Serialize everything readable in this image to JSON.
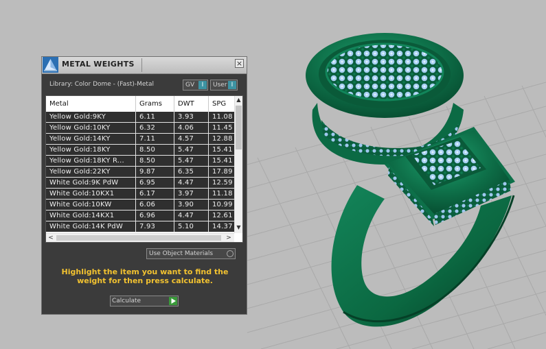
{
  "panel": {
    "title": "METAL WEIGHTS",
    "close_glyph": "×",
    "library_label": "Library: Color Dome - (Fast)-Metal",
    "toggles": [
      {
        "label": "GV",
        "indicator": "I"
      },
      {
        "label": "User",
        "indicator": "I"
      }
    ],
    "table": {
      "columns": [
        "Metal",
        "Grams",
        "DWT",
        "SPG"
      ],
      "rows": [
        [
          "Yellow Gold:9KY",
          "6.11",
          "3.93",
          "11.08"
        ],
        [
          "Yellow Gold:10KY",
          "6.32",
          "4.06",
          "11.45"
        ],
        [
          "Yellow Gold:14KY",
          "7.11",
          "4.57",
          "12.88"
        ],
        [
          "Yellow Gold:18KY",
          "8.50",
          "5.47",
          "15.41"
        ],
        [
          "Yellow Gold:18KY R...",
          "8.50",
          "5.47",
          "15.41"
        ],
        [
          "Yellow Gold:22KY",
          "9.87",
          "6.35",
          "17.89"
        ],
        [
          "White Gold:9K PdW",
          "6.95",
          "4.47",
          "12.59"
        ],
        [
          "White Gold:10KX1",
          "6.17",
          "3.97",
          "11.18"
        ],
        [
          "White Gold:10KW",
          "6.06",
          "3.90",
          "10.99"
        ],
        [
          "White Gold:14KX1",
          "6.96",
          "4.47",
          "12.61"
        ],
        [
          "White Gold:14K PdW",
          "7.93",
          "5.10",
          "14.37"
        ]
      ]
    },
    "scroll": {
      "up": "▲",
      "down": "▼",
      "left": "<",
      "right": ">"
    },
    "use_object_materials": "Use Object Materials",
    "instruction": "Highlight the item you want to find the weight for then press calculate.",
    "calculate": "Calculate"
  },
  "icons": {
    "logo": "pyramid-logo-icon",
    "close": "close-icon",
    "calc_play": "play-icon"
  },
  "colors": {
    "accent": "#f2c230",
    "ring": "#0e7049",
    "gems": "#9ec8ef"
  }
}
